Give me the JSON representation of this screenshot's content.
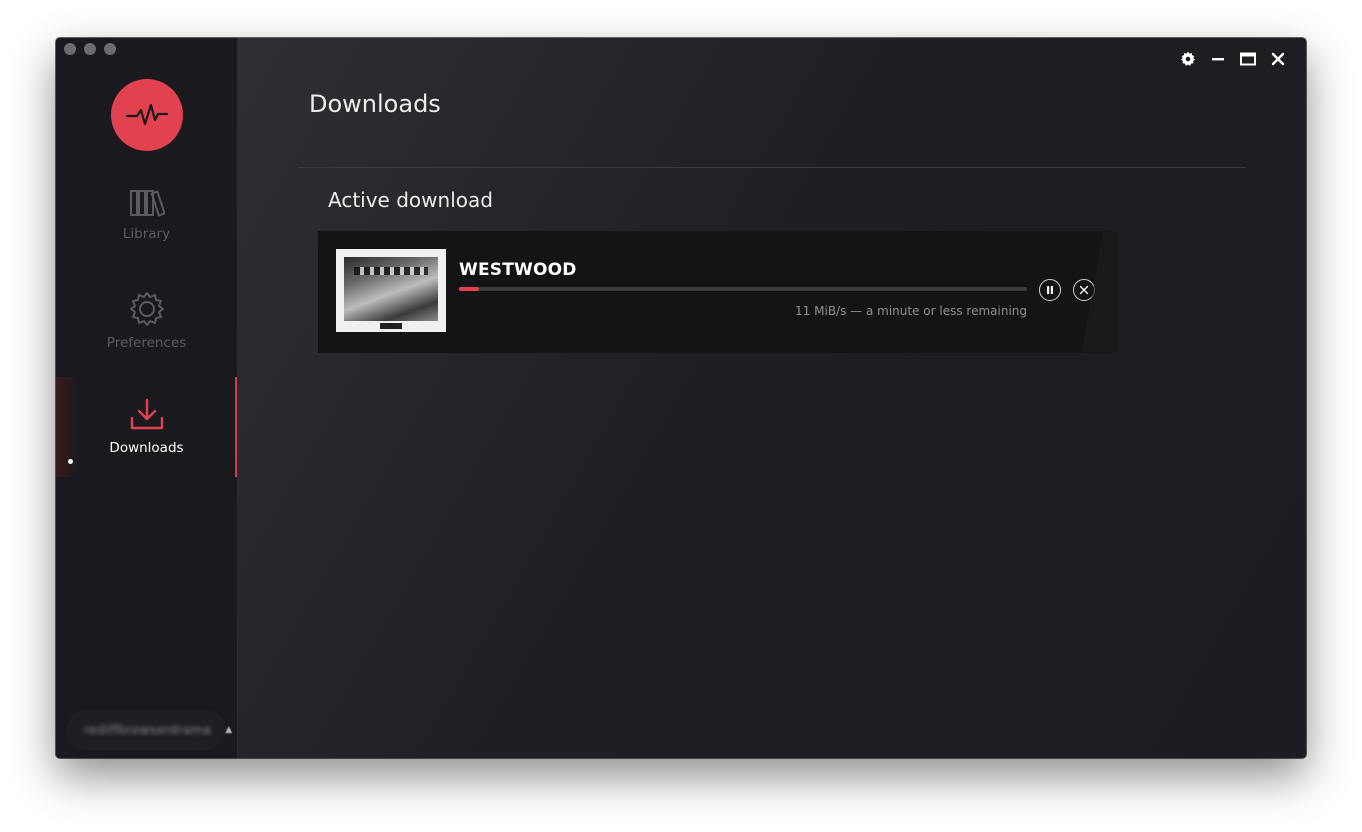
{
  "sidebar": {
    "logo_icon": "waveform-icon",
    "items": [
      {
        "label": "Library",
        "icon": "library-icon"
      },
      {
        "label": "Preferences",
        "icon": "gear-icon"
      },
      {
        "label": "Downloads",
        "icon": "download-icon",
        "active": true
      }
    ],
    "account": {
      "name": "rediffbrowserdrama",
      "icon": "eject-icon"
    }
  },
  "titlebar": {
    "icons": [
      "gear-icon",
      "minimize-icon",
      "maximize-icon",
      "close-icon"
    ]
  },
  "main": {
    "title": "Downloads",
    "section_title": "Active download",
    "download": {
      "title": "WESTWOOD",
      "progress": 0.035,
      "status": "11 MiB/s — a minute or less remaining",
      "pause_icon": "pause-icon",
      "cancel_icon": "close-icon"
    }
  },
  "colors": {
    "accent": "#e2424f",
    "sidebar_bg": "#1a1a1e",
    "main_bg": "#1f1f23",
    "card_bg": "#141417"
  }
}
